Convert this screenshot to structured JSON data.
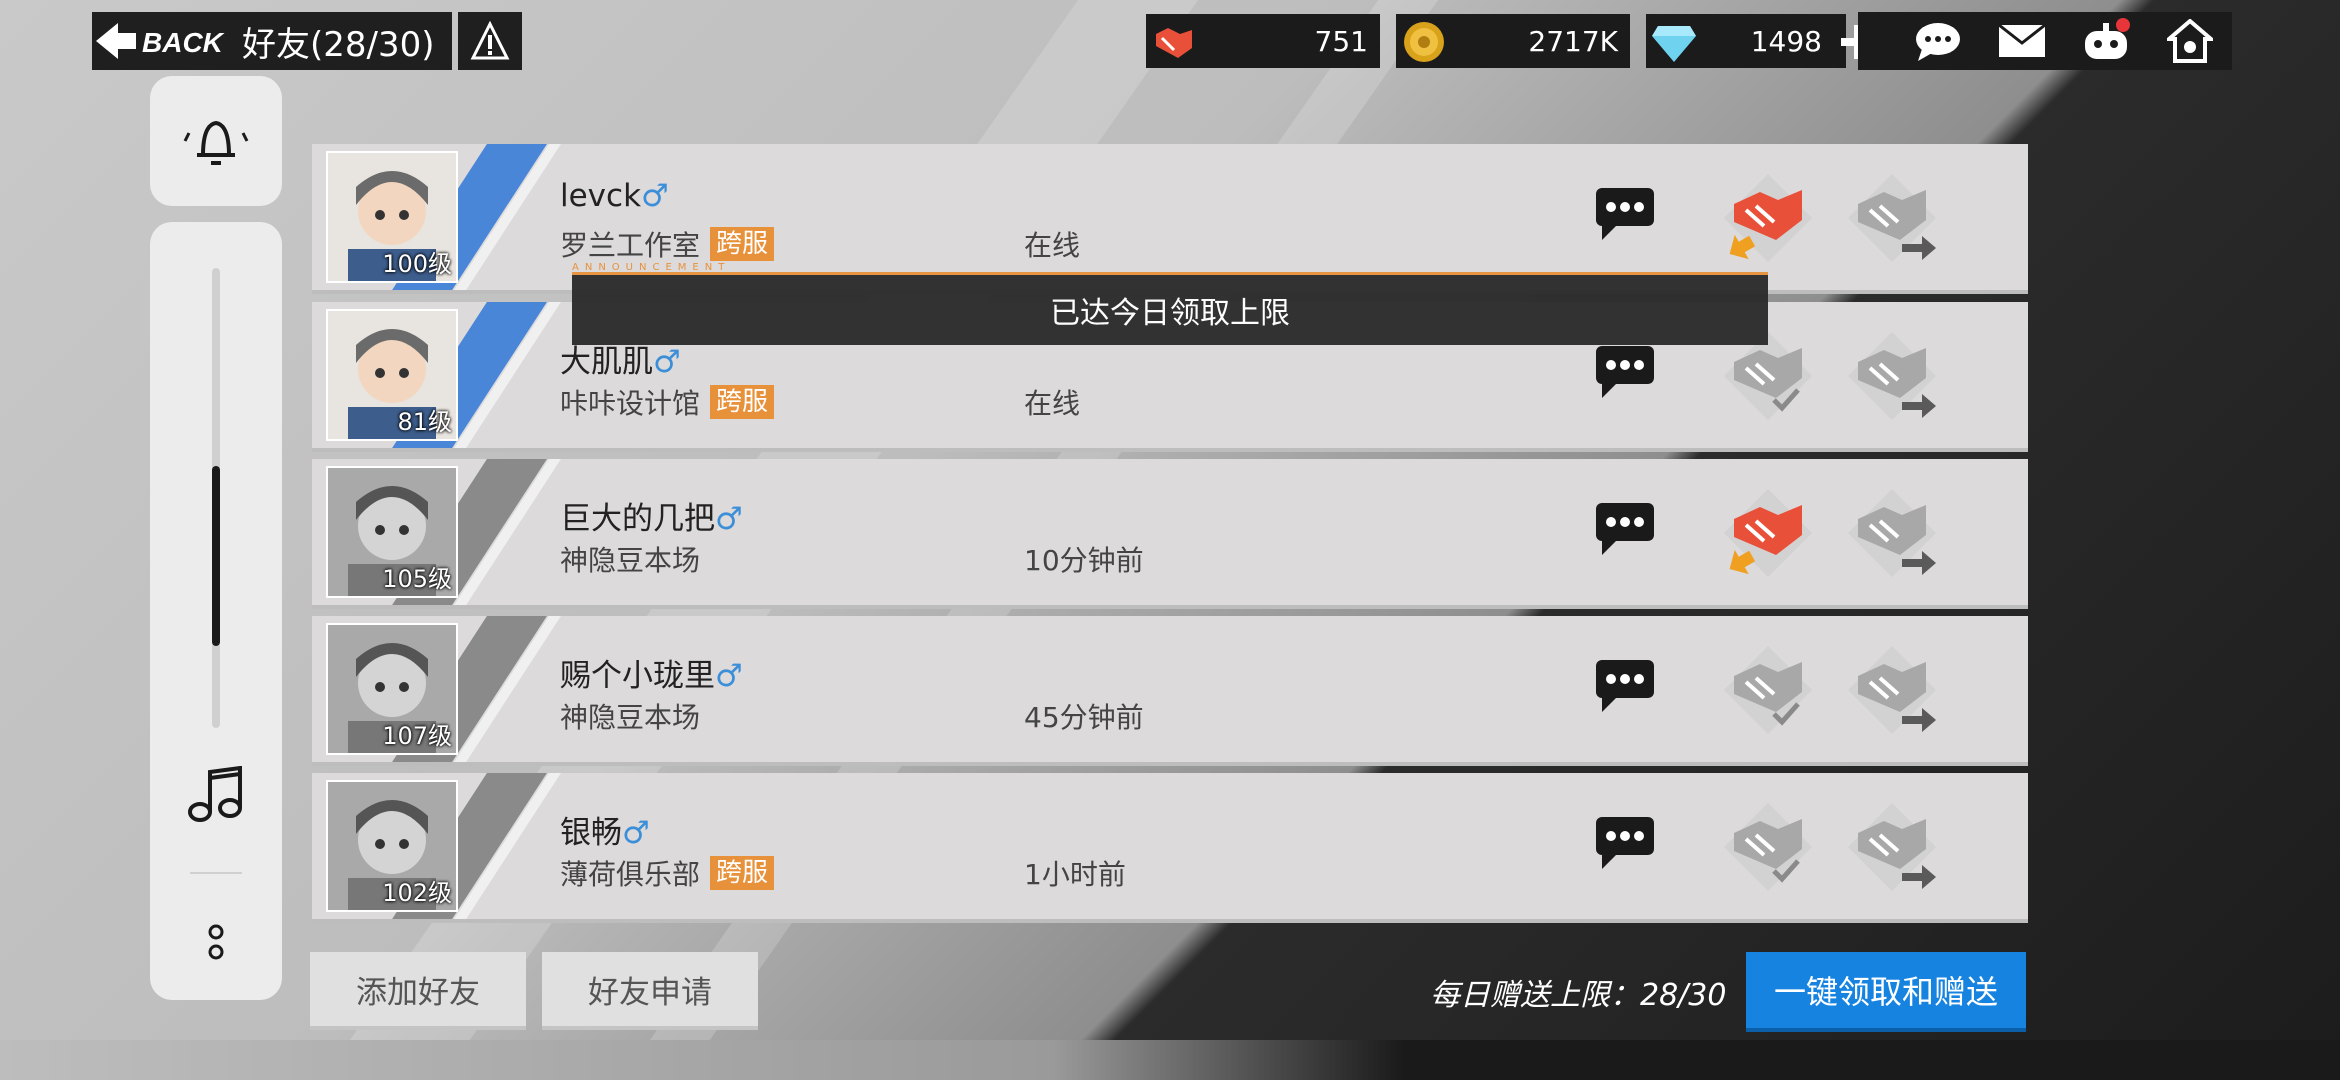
{
  "header": {
    "back_label": "BACK",
    "title": "好友(28/30)"
  },
  "resources": {
    "friendship": "751",
    "coins": "2717K",
    "diamonds": "1498"
  },
  "toast": {
    "message": "已达今日领取上限",
    "caption": "ANNOUNCEMENT"
  },
  "friends": [
    {
      "name": "levck",
      "gender": "♂",
      "club": "罗兰工作室",
      "cross": "跨服",
      "level": "100级",
      "status": "在线",
      "gift_received": true,
      "online": true
    },
    {
      "name": "大肌肌",
      "gender": "♂",
      "club": "咔咔设计馆",
      "cross": "跨服",
      "level": "81级",
      "status": "在线",
      "gift_received": false,
      "online": true
    },
    {
      "name": "巨大的几把",
      "gender": "♂",
      "club": "神隐豆本场",
      "cross": "",
      "level": "105级",
      "status": "10分钟前",
      "gift_received": true,
      "online": false
    },
    {
      "name": "赐个小珑里",
      "gender": "♂",
      "club": "神隐豆本场",
      "cross": "",
      "level": "107级",
      "status": "45分钟前",
      "gift_received": false,
      "online": false
    },
    {
      "name": "银畅",
      "gender": "♂",
      "club": "薄荷俱乐部",
      "cross": "跨服",
      "level": "102级",
      "status": "1小时前",
      "gift_received": false,
      "online": false
    }
  ],
  "footer": {
    "add_friend": "添加好友",
    "friend_requests": "好友申请",
    "daily_limit": "每日赠送上限：28/30",
    "claim_all": "一键领取和赠送"
  },
  "colors": {
    "accent_blue": "#4a86d8",
    "cross_orange": "#e8913b",
    "gift_red": "#e8503a",
    "button_blue": "#1783e0"
  }
}
